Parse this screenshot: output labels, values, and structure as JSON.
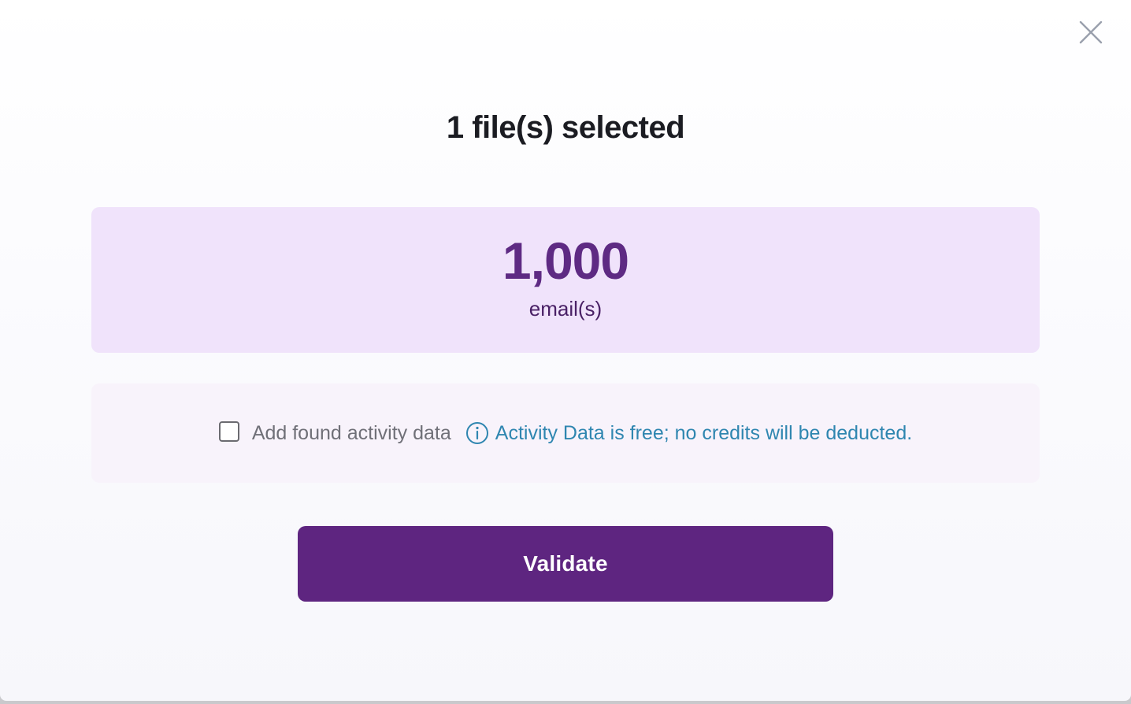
{
  "dialog": {
    "close_icon": "close-icon",
    "title": "1 file(s) selected",
    "count": {
      "value": "1,000",
      "unit": "email(s)"
    },
    "activity": {
      "checkbox_checked": false,
      "label": "Add found activity data",
      "info_icon": "info-icon",
      "info_text": "Activity Data is free; no credits will be deducted."
    },
    "validate_label": "Validate"
  },
  "colors": {
    "accent": "#5e2580",
    "count_card_bg": "#f0e3fb",
    "count_value": "#5e2a83",
    "info_text": "#2f86b0",
    "activity_card_bg": "#f8f3fb"
  }
}
